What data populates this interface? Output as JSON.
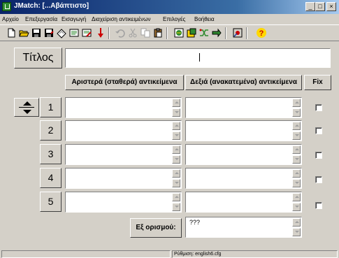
{
  "window": {
    "title": "JMatch: [...Αβάπτιστο]",
    "minimize_glyph": "_",
    "maximize_glyph": "□",
    "close_glyph": "×"
  },
  "menu": [
    "Αρχείο",
    "Επεξεργασία",
    "Εισαγωγή",
    "Διαχείριση αντικειμένων",
    "Επιλογές",
    "Βοήθεια"
  ],
  "toolbar": {
    "icons": [
      "new-file-icon",
      "open-folder-icon",
      "save-icon",
      "save-as-icon",
      "clear-icon",
      "config-icon",
      "config-edit-icon",
      "down-arrow-icon",
      "undo-icon",
      "cut-icon",
      "copy-icon",
      "paste-icon",
      "web-page-icon",
      "export-icon",
      "shuffle-icon",
      "move-icon",
      "settings-icon",
      "help-icon"
    ],
    "help_glyph": "?",
    "accent_red": "#cc0000",
    "accent_yellow": "#ffd800"
  },
  "form": {
    "title_label": "Τίτλος",
    "title_value": "",
    "left_header": "Αριστερά (σταθερά) αντικείμενα",
    "right_header": "Δεξιά (ανακατεμένα) αντικείμενα",
    "fix_header": "Fix",
    "rows": [
      {
        "number": "1",
        "left": "",
        "right": "",
        "fixed": false
      },
      {
        "number": "2",
        "left": "",
        "right": "",
        "fixed": false
      },
      {
        "number": "3",
        "left": "",
        "right": "",
        "fixed": false
      },
      {
        "number": "4",
        "left": "",
        "right": "",
        "fixed": false
      },
      {
        "number": "5",
        "left": "",
        "right": "",
        "fixed": false
      }
    ],
    "default_label": "Εξ ορισμού:",
    "default_value": "???"
  },
  "status": {
    "config": "Ρύθμιση: english6.cfg"
  },
  "colors": {
    "title_bar_start": "#0a246a",
    "title_bar_end": "#a6caf0",
    "face": "#d4d0c8"
  }
}
